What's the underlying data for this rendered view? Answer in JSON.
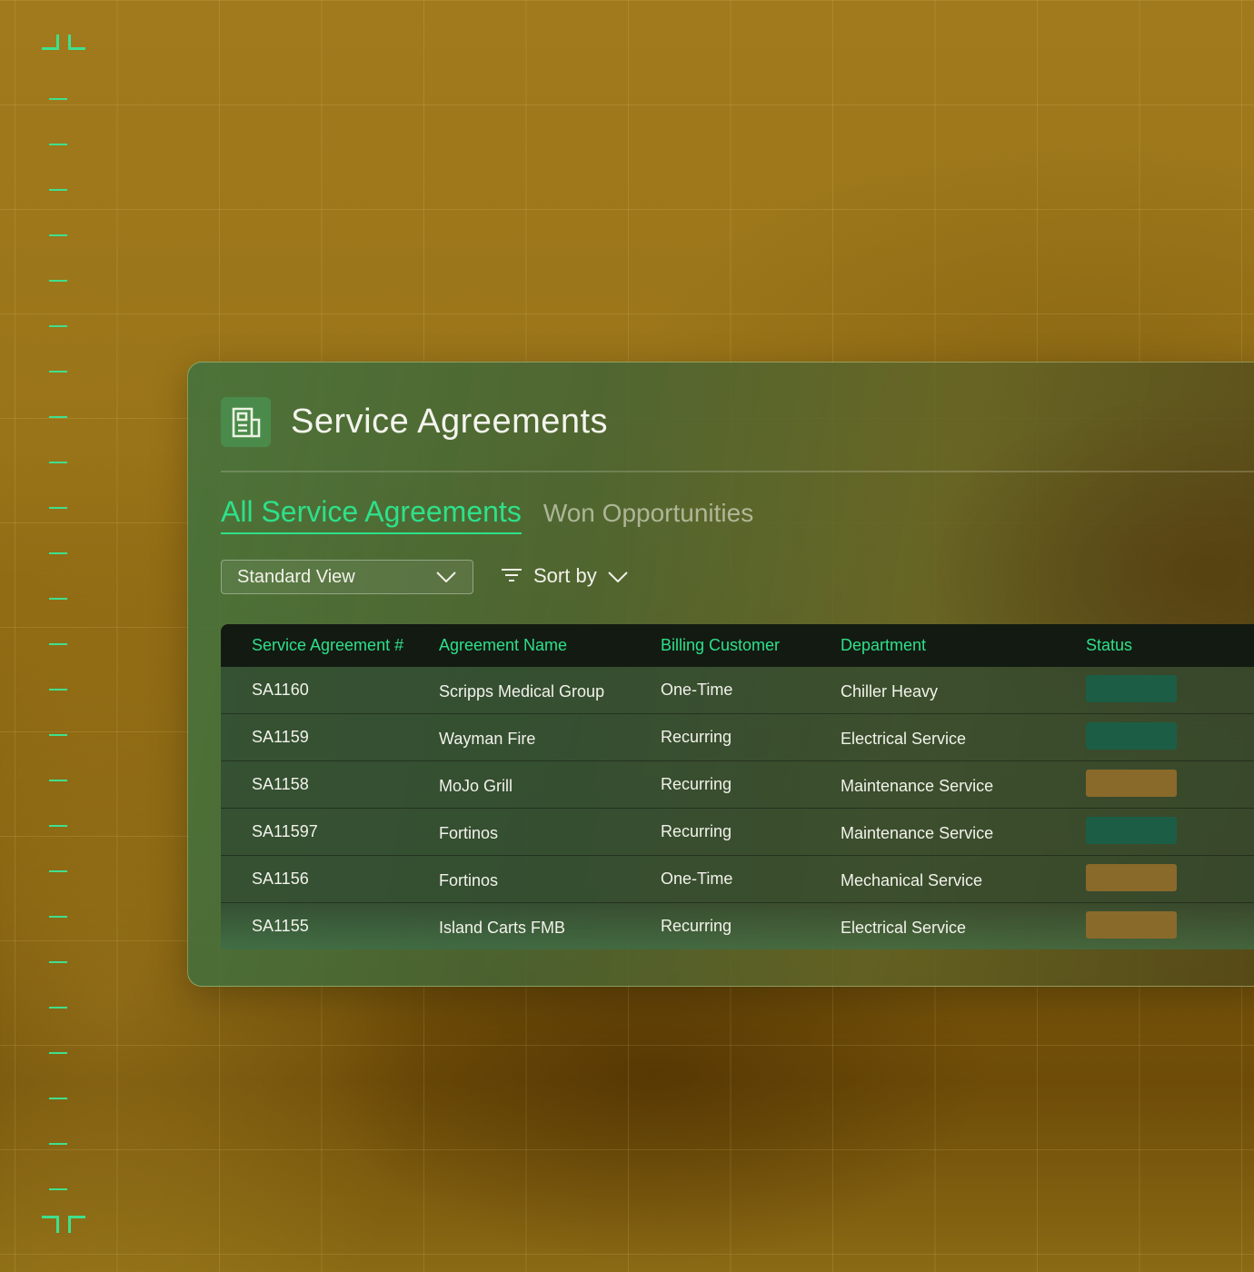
{
  "page": {
    "title": "Service Agreements",
    "icon": "document-icon"
  },
  "tabs": [
    {
      "label": "All Service Agreements",
      "active": true
    },
    {
      "label": "Won Opportunities",
      "active": false
    }
  ],
  "toolbar": {
    "view_select": {
      "value": "Standard View",
      "icon": "chevron-down-icon"
    },
    "sort": {
      "label": "Sort by",
      "icon": "filter-lines-icon"
    }
  },
  "table": {
    "columns": [
      "Service Agreement #",
      "Agreement Name",
      "Billing Customer",
      "Department",
      "Status"
    ],
    "rows": [
      {
        "id": "SA1160",
        "name": "Scripps Medical Group",
        "billing": "One-Time",
        "department": "Chiller Heavy",
        "status_color": "#1b5e45"
      },
      {
        "id": "SA1159",
        "name": "Wayman Fire",
        "billing": "Recurring",
        "department": "Electrical Service",
        "status_color": "#1b5e45"
      },
      {
        "id": "SA1158",
        "name": "MoJo Grill",
        "billing": "Recurring",
        "department": "Maintenance Service",
        "status_color": "#8a6a2a"
      },
      {
        "id": "SA11597",
        "name": "Fortinos",
        "billing": "Recurring",
        "department": "Maintenance Service",
        "status_color": "#1b5e45"
      },
      {
        "id": "SA1156",
        "name": "Fortinos",
        "billing": "One-Time",
        "department": "Mechanical Service",
        "status_color": "#8a6a2a"
      },
      {
        "id": "SA1155",
        "name": "Island Carts FMB",
        "billing": "Recurring",
        "department": "Electrical Service",
        "status_color": "#8a6a2a"
      }
    ]
  },
  "colors": {
    "accent": "#2ee08a",
    "frame_marks": "#3ee08f"
  }
}
